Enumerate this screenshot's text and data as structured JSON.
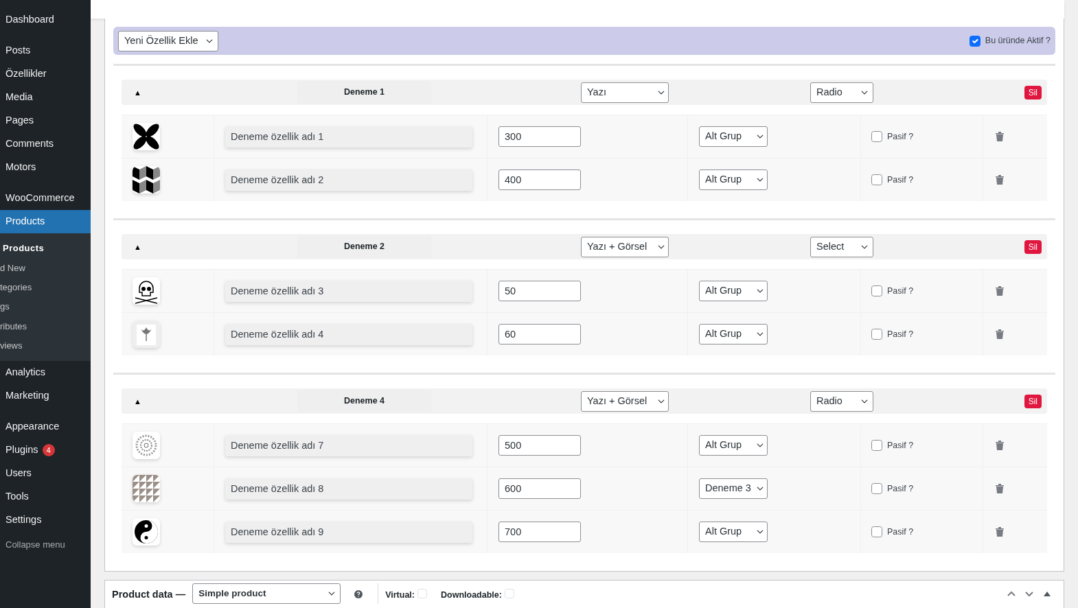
{
  "sidebar": {
    "groups": [
      [
        {
          "label": "Dashboard",
          "selected": false
        }
      ],
      [
        {
          "label": "Posts",
          "selected": false
        },
        {
          "label": "Özellikler",
          "selected": false
        },
        {
          "label": "Media",
          "selected": false
        },
        {
          "label": "Pages",
          "selected": false
        },
        {
          "label": "Comments",
          "selected": false
        },
        {
          "label": "Motors",
          "selected": false
        }
      ],
      [
        {
          "label": "WooCommerce",
          "selected": false
        },
        {
          "label": "Products",
          "selected": true,
          "submenu": [
            {
              "label": "Products",
              "selected": true
            },
            {
              "label": "d New",
              "selected": false
            },
            {
              "label": "tegories",
              "selected": false
            },
            {
              "label": "gs",
              "selected": false
            },
            {
              "label": "ributes",
              "selected": false
            },
            {
              "label": "views",
              "selected": false
            }
          ]
        },
        {
          "label": "Analytics",
          "selected": false
        },
        {
          "label": "Marketing",
          "selected": false
        }
      ],
      [
        {
          "label": "Appearance",
          "selected": false
        },
        {
          "label": "Plugins",
          "selected": false,
          "badge": "4"
        },
        {
          "label": "Users",
          "selected": false
        },
        {
          "label": "Tools",
          "selected": false
        },
        {
          "label": "Settings",
          "selected": false
        }
      ]
    ],
    "collapse": "Collapse menu"
  },
  "feature_bar": {
    "add_select": "Yeni Özellik Ekle",
    "active_label": "Bu üründe Aktif ?",
    "active_checked": true
  },
  "groups": [
    {
      "toggle": "▲",
      "title": "Deneme 1",
      "type": "Yazı",
      "display": "Radio",
      "delete": "Sil",
      "rows": [
        {
          "name": "Deneme özellik adı 1",
          "value": "300",
          "subgroup": "Alt Grup",
          "passive_label": "Pasif ?",
          "passive": false
        },
        {
          "name": "Deneme özellik adı 2",
          "value": "400",
          "subgroup": "Alt Grup",
          "passive_label": "Pasif ?",
          "passive": false
        }
      ]
    },
    {
      "toggle": "▲",
      "title": "Deneme 2",
      "type": "Yazı + Görsel",
      "display": "Select",
      "delete": "Sil",
      "rows": [
        {
          "name": "Deneme özellik adı 3",
          "value": "50",
          "subgroup": "Alt Grup",
          "passive_label": "Pasif ?",
          "passive": false
        },
        {
          "name": "Deneme özellik adı 4",
          "value": "60",
          "subgroup": "Alt Grup",
          "passive_label": "Pasif ?",
          "passive": false
        }
      ]
    },
    {
      "toggle": "▲",
      "title": "Deneme 4",
      "type": "Yazı + Görsel",
      "display": "Radio",
      "delete": "Sil",
      "rows": [
        {
          "name": "Deneme özellik adı 7",
          "value": "500",
          "subgroup": "Alt Grup",
          "passive_label": "Pasif ?",
          "passive": false
        },
        {
          "name": "Deneme özellik adı 8",
          "value": "600",
          "subgroup": "Deneme 3",
          "passive_label": "Pasif ?",
          "passive": false
        },
        {
          "name": "Deneme özellik adı 9",
          "value": "700",
          "subgroup": "Alt Grup",
          "passive_label": "Pasif ?",
          "passive": false
        }
      ]
    }
  ],
  "product_data": {
    "label": "Product data —",
    "type_select": "Simple product",
    "virtual_label": "Virtual:",
    "virtual": false,
    "downloadable_label": "Downloadable:",
    "downloadable": false
  }
}
